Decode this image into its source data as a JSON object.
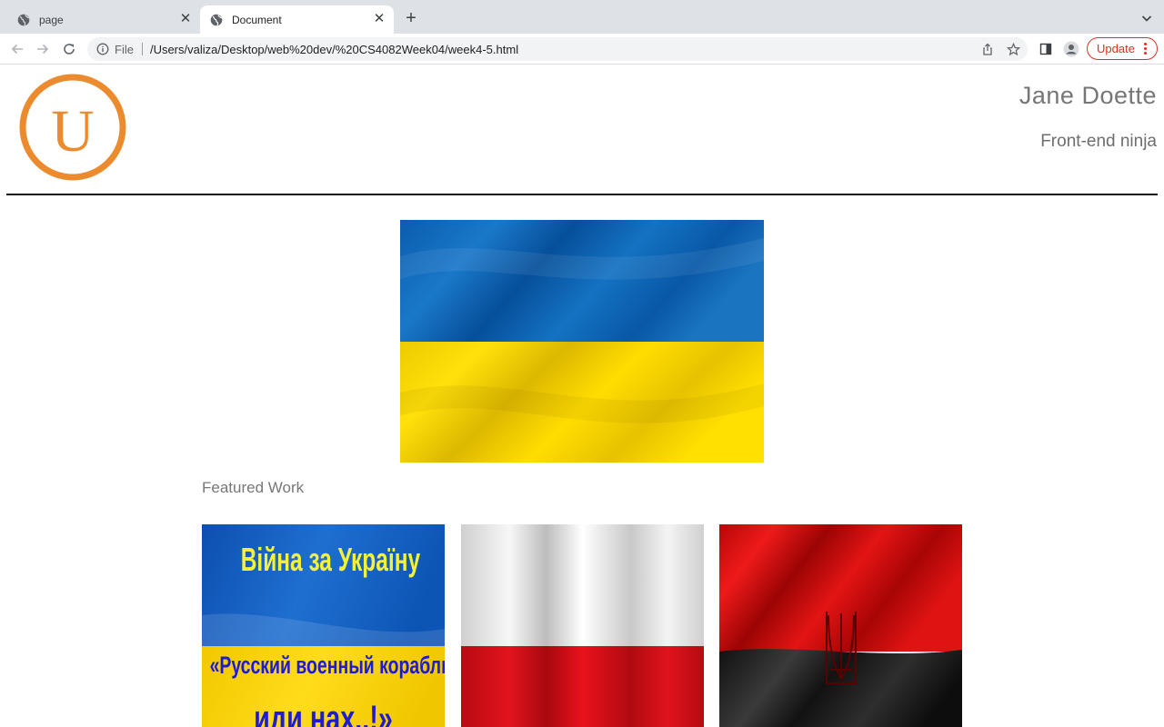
{
  "browser": {
    "tabs": [
      {
        "title": "page",
        "active": false
      },
      {
        "title": "Document",
        "active": true
      }
    ],
    "address": {
      "scheme_label": "File",
      "url": "/Users/valiza/Desktop/web%20dev/%20CS4082Week04/week4-5.html"
    },
    "update_label": "Update",
    "colors": {
      "update": "#d93025",
      "tabstrip": "#dee1e6"
    }
  },
  "header": {
    "logo_letter": "U",
    "name": "Jane Doette",
    "tagline": "Front-end ninja",
    "colors": {
      "logo": "#ec8b2e"
    }
  },
  "main": {
    "featured_heading": "Featured Work",
    "works": [
      {
        "line1": "Війна за Україну",
        "line2": "«Русский военный корабль,",
        "line3": "иди нах..!»"
      },
      {},
      {}
    ],
    "colors": {
      "ua_blue": "#0a5fb4",
      "ua_yellow": "#f6d300",
      "pl_red": "#d4111a",
      "upa_red": "#d40d0d",
      "upa_black": "#1a1a1a"
    }
  }
}
